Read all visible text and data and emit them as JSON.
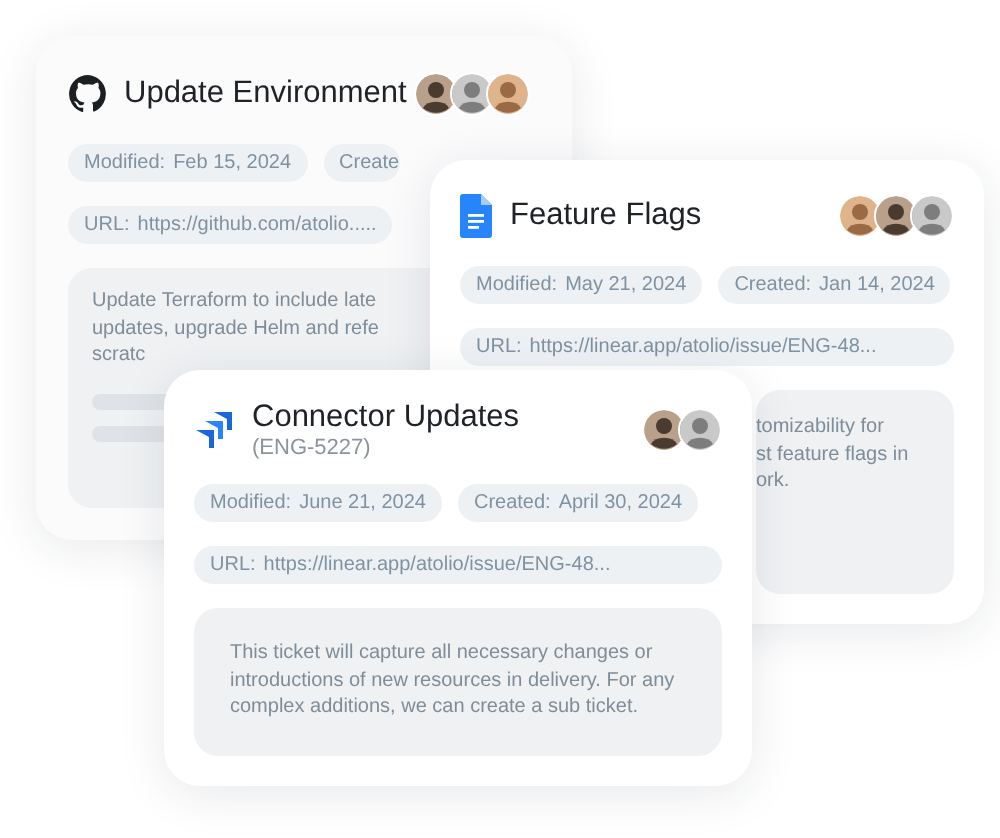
{
  "cards": [
    {
      "kind": "github",
      "title": "Update Environment",
      "avatars": [
        {
          "kind": "dark"
        },
        {
          "kind": "grey"
        },
        {
          "kind": "warm"
        }
      ],
      "meta": [
        {
          "label": "Modified:",
          "value": "Feb 15, 2024"
        },
        {
          "label": "Create"
        }
      ],
      "url": {
        "label": "URL:",
        "value": "https://github.com/atolio....."
      },
      "description": [
        "Update Terraform to include late",
        "updates, upgrade Helm and refe",
        "scratc"
      ],
      "skeleton": true
    },
    {
      "kind": "docs",
      "title": "Feature Flags",
      "avatars": [
        {
          "kind": "warm"
        },
        {
          "kind": "dark"
        },
        {
          "kind": "grey"
        }
      ],
      "meta": [
        {
          "label": "Modified:",
          "value": "May 21, 2024"
        },
        {
          "label": "Created:",
          "value": "Jan 14, 2024"
        }
      ],
      "url": {
        "label": "URL:",
        "value": "https://linear.app/atolio/issue/ENG-48..."
      },
      "description": [
        "tomizability for",
        "st feature flags in",
        "ork."
      ],
      "skeleton": false
    },
    {
      "kind": "jira",
      "title": "Connector Updates",
      "subtitle": "(ENG-5227)",
      "avatars": [
        {
          "kind": "dark"
        },
        {
          "kind": "grey"
        }
      ],
      "meta": [
        {
          "label": "Modified:",
          "value": "June 21, 2024"
        },
        {
          "label": "Created:",
          "value": "April 30, 2024"
        }
      ],
      "url": {
        "label": "URL:",
        "value": "https://linear.app/atolio/issue/ENG-48..."
      },
      "description": [
        "This ticket will capture all necessary changes or introductions of new resources in delivery. For any complex additions, we can create a sub ticket."
      ],
      "skeleton": false
    }
  ]
}
